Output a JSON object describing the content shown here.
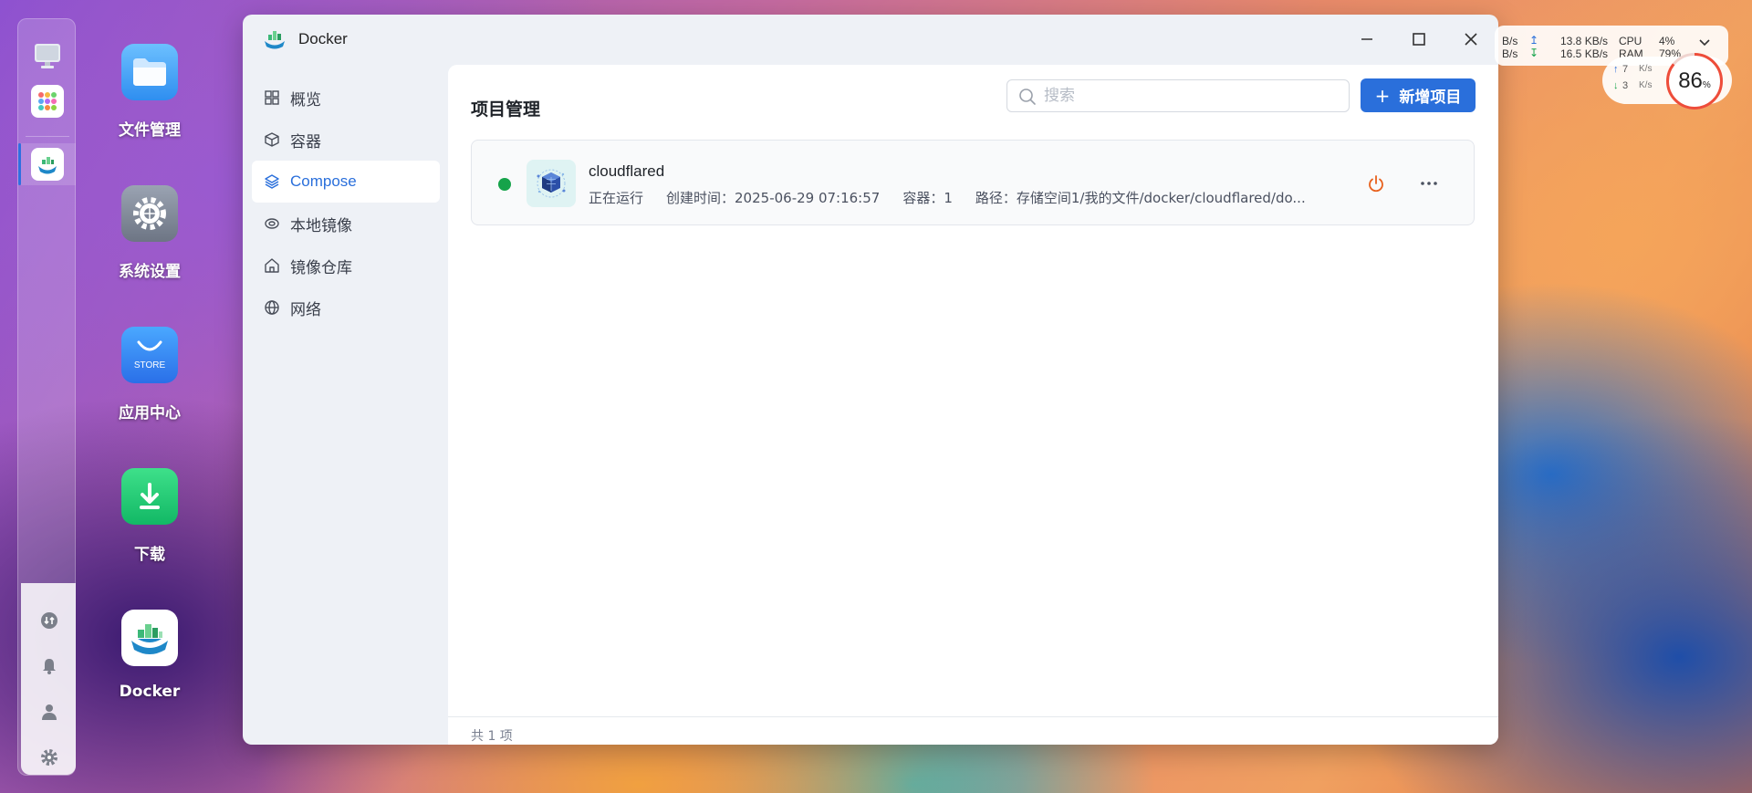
{
  "window": {
    "title": "Docker",
    "controls": {
      "minimize": "minimize-icon",
      "maximize": "maximize-icon",
      "close": "close-icon"
    }
  },
  "sidebar": {
    "items": [
      {
        "label": "概览",
        "icon": "grid-icon"
      },
      {
        "label": "容器",
        "icon": "cube-icon"
      },
      {
        "label": "Compose",
        "icon": "layers-icon",
        "active": true
      },
      {
        "label": "本地镜像",
        "icon": "eye-icon"
      },
      {
        "label": "镜像仓库",
        "icon": "warehouse-icon"
      },
      {
        "label": "网络",
        "icon": "globe-icon"
      }
    ]
  },
  "main": {
    "title": "项目管理",
    "search": {
      "placeholder": "搜索",
      "value": ""
    },
    "add_button": {
      "plus": "+",
      "label": "新增项目"
    },
    "projects": [
      {
        "name": "cloudflared",
        "status": "正在运行",
        "status_color": "#16a34a",
        "created": "创建时间：2025-06-29 07:16:57",
        "containers": "容器：1",
        "path": "路径：存储空间1/我的文件/docker/cloudflared/do..."
      }
    ],
    "footer": "共 1 项"
  },
  "desktop": {
    "icons": [
      {
        "label": "文件管理"
      },
      {
        "label": "系统设置"
      },
      {
        "label": "应用中心",
        "badge": "STORE"
      },
      {
        "label": "下载"
      },
      {
        "label": "Docker"
      }
    ]
  },
  "widgets": {
    "net_left_up": "B/s",
    "net_left_down": "B/s",
    "upload": "13.8 KB/s",
    "download": "16.5 KB/s",
    "cpu_label": "CPU",
    "cpu_value": "4%",
    "ram_label": "RAM",
    "ram_value": "79%",
    "small_up": "7",
    "small_up_unit": "K/s",
    "small_down": "3",
    "small_down_unit": "K/s",
    "gauge_value": "86",
    "gauge_unit": "%"
  },
  "colors": {
    "accent": "#2a6fdb",
    "running": "#16a34a",
    "power": "#e8601c"
  }
}
